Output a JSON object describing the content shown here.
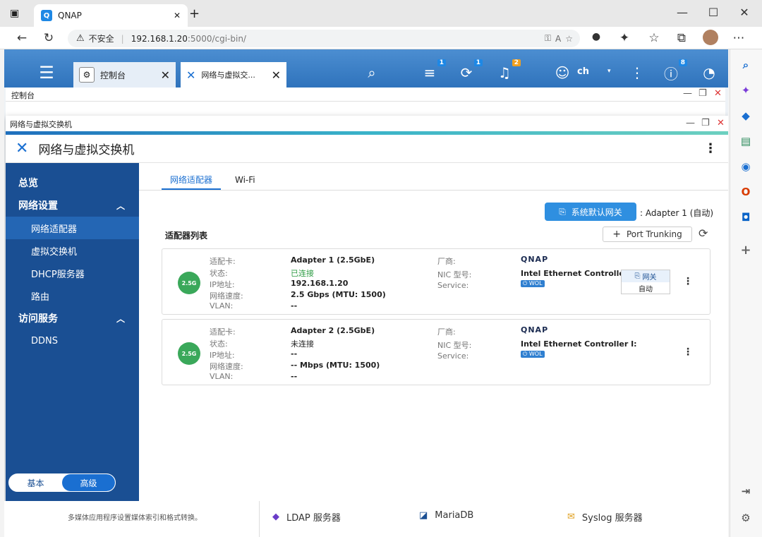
{
  "browser": {
    "tab_title": "QNAP",
    "favicon": "Q",
    "new_tab": "+",
    "close_tab": "✕",
    "security_label": "不安全",
    "url_host": "192.168.1.20",
    "url_rest": ":5000/cgi-bin/"
  },
  "qnap_top": {
    "tabs": [
      {
        "label": "控制台",
        "close": "✕"
      },
      {
        "label": "网络与虚拟交...",
        "close": "✕"
      }
    ],
    "badges": {
      "tasks": "1",
      "sync": "1",
      "notifications": "2",
      "info": "8"
    },
    "user": "ch"
  },
  "cp_window": {
    "title": "控制台",
    "buttons": {
      "minimize": "—",
      "maximize": "❐",
      "close": "✕"
    }
  },
  "net_window": {
    "title": "网络与虚拟交换机",
    "header_title": "网络与虚拟交换机",
    "buttons": {
      "minimize": "—",
      "maximize": "❐",
      "close": "✕"
    }
  },
  "sidebar": {
    "items": [
      {
        "label": "总览",
        "type": "section"
      },
      {
        "label": "网络设置",
        "type": "section",
        "expanded": true
      },
      {
        "label": "网络适配器",
        "type": "sub",
        "active": true
      },
      {
        "label": "虚拟交换机",
        "type": "sub"
      },
      {
        "label": "DHCP服务器",
        "type": "sub"
      },
      {
        "label": "路由",
        "type": "sub"
      },
      {
        "label": "访问服务",
        "type": "section",
        "expanded": true
      },
      {
        "label": "DDNS",
        "type": "sub"
      }
    ],
    "mode": {
      "basic": "基本",
      "advanced": "高级"
    }
  },
  "content": {
    "tabs": [
      "网络适配器",
      "Wi-Fi"
    ],
    "default_gateway_button": "系统默认网关",
    "default_gateway_value": "Adapter 1 (自动)",
    "section_title": "适配器列表",
    "port_trunking_button": "Port Trunking",
    "labels": {
      "adapter": "适配卡:",
      "status": "状态:",
      "ip": "IP地址:",
      "speed": "网络速度:",
      "vlan": "VLAN:",
      "vendor": "厂商:",
      "nic": "NIC 型号:",
      "service": "Service:"
    },
    "adapters": [
      {
        "name": "Adapter 1 (2.5GbE)",
        "status": "已连接",
        "ip": "192.168.1.20",
        "speed": "2.5 Gbps (MTU: 1500)",
        "vlan": "--",
        "vendor": "QNAP",
        "nic": "Intel Ethernet Controller I:",
        "service": "WOL",
        "badge": "2.5G",
        "connected": true
      },
      {
        "name": "Adapter 2 (2.5GbE)",
        "status": "未连接",
        "ip": "--",
        "speed": "-- Mbps (MTU: 1500)",
        "vlan": "--",
        "vendor": "QNAP",
        "nic": "Intel Ethernet Controller I:",
        "service": "WOL",
        "badge": "2.5G",
        "connected": false
      }
    ],
    "gateway_popup": {
      "top": "网关",
      "bottom": "自动"
    }
  },
  "bottom_apps": [
    {
      "label": "LDAP 服务器"
    },
    {
      "label": "MariaDB"
    },
    {
      "label": "Syslog 服务器"
    }
  ],
  "bottom_note": "多媒体应用程序设置媒体索引和格式转换。",
  "colors": {
    "sidebar_bg": "#1a4f93",
    "accent": "#1a6fd1",
    "connected_green": "#2e9c44",
    "top_bar": "#3a80c8"
  }
}
